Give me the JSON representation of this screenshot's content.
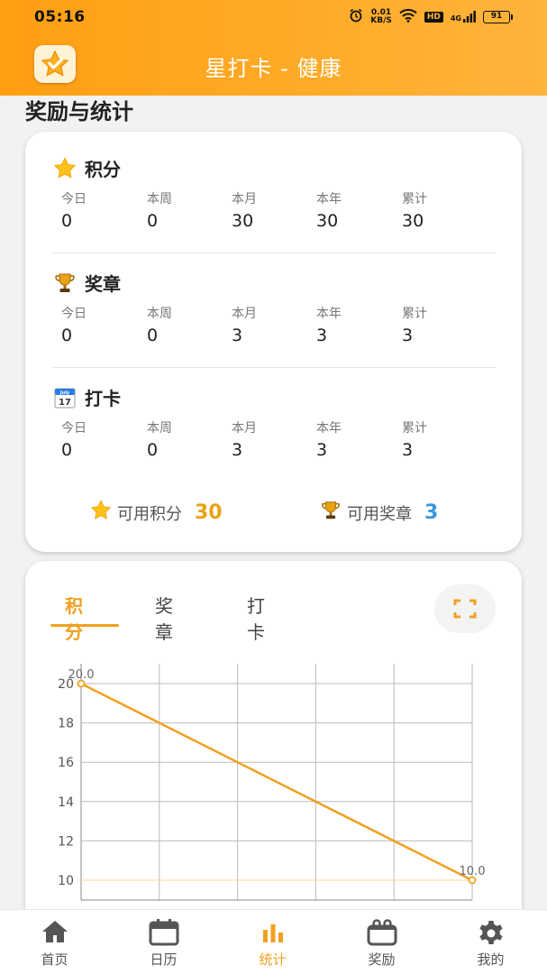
{
  "status_bar": {
    "time": "05:16",
    "net_speed_top": "0.01",
    "net_speed_bottom": "KB/S",
    "hd": "HD",
    "signal": "4G",
    "battery": "91"
  },
  "header": {
    "title": "星打卡 - 健康"
  },
  "section_title": "奖励与统计",
  "stats": {
    "groups": [
      {
        "title": "积分",
        "icon": "star-icon",
        "columns": [
          {
            "label": "今日",
            "value": "0"
          },
          {
            "label": "本周",
            "value": "0"
          },
          {
            "label": "本月",
            "value": "30"
          },
          {
            "label": "本年",
            "value": "30"
          },
          {
            "label": "累计",
            "value": "30"
          }
        ]
      },
      {
        "title": "奖章",
        "icon": "trophy-icon",
        "columns": [
          {
            "label": "今日",
            "value": "0"
          },
          {
            "label": "本周",
            "value": "0"
          },
          {
            "label": "本月",
            "value": "3"
          },
          {
            "label": "本年",
            "value": "3"
          },
          {
            "label": "累计",
            "value": "3"
          }
        ]
      },
      {
        "title": "打卡",
        "icon": "calendar-icon",
        "columns": [
          {
            "label": "今日",
            "value": "0"
          },
          {
            "label": "本周",
            "value": "0"
          },
          {
            "label": "本月",
            "value": "3"
          },
          {
            "label": "本年",
            "value": "3"
          },
          {
            "label": "累计",
            "value": "3"
          }
        ]
      }
    ],
    "available_points_label": "可用积分",
    "available_points_value": "30",
    "available_medals_label": "可用奖章",
    "available_medals_value": "3",
    "calendar_icon_text_top": "July",
    "calendar_icon_text_bottom": "17"
  },
  "chart_tabs": [
    "积分",
    "奖章",
    "打卡"
  ],
  "chart_data": {
    "type": "line",
    "x": [
      0,
      5
    ],
    "series": [
      {
        "values": [
          20.0,
          10.0
        ]
      }
    ],
    "data_labels": [
      "20.0",
      "10.0"
    ],
    "y_ticks": [
      "10",
      "12",
      "14",
      "16",
      "18",
      "20"
    ],
    "ylim": [
      10,
      20
    ],
    "grid": true,
    "color": "#f0a020"
  },
  "colors": {
    "accent": "#f0a020",
    "header_start": "#ff9f12",
    "header_end": "#ffb43a",
    "medal_blue": "#3a9ad9"
  },
  "bottom_nav": [
    {
      "label": "首页",
      "icon": "home-icon"
    },
    {
      "label": "日历",
      "icon": "calendar-icon"
    },
    {
      "label": "统计",
      "icon": "bar-chart-icon",
      "active": true
    },
    {
      "label": "奖励",
      "icon": "gift-box-icon"
    },
    {
      "label": "我的",
      "icon": "gear-icon"
    }
  ]
}
